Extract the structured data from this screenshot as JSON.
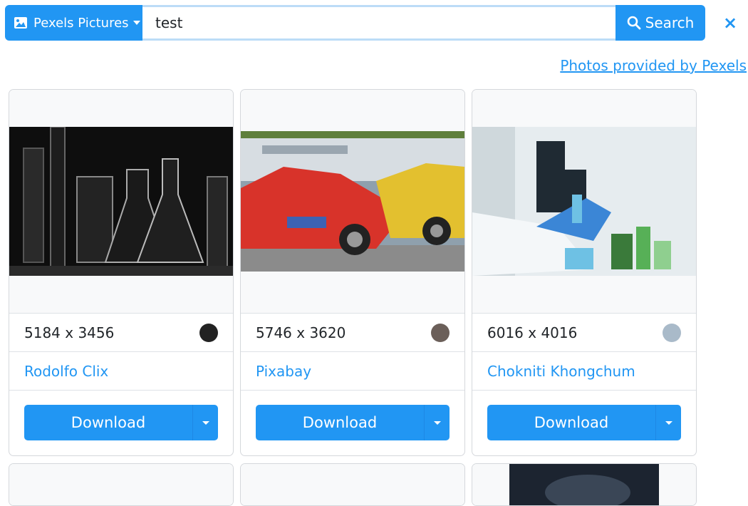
{
  "search": {
    "source_label": "Pexels Pictures",
    "query": "test",
    "button_label": "Search",
    "close_symbol": "×"
  },
  "credit": {
    "text": "Photos provided by Pexels"
  },
  "colors": {
    "accent": "#2196f3"
  },
  "photos": [
    {
      "dimensions": "5184 x 3456",
      "swatch": "#222222",
      "author": "Rodolfo Clix",
      "download_label": "Download",
      "image": "lab-glassware-dark"
    },
    {
      "dimensions": "5746 x 3620",
      "swatch": "#6b5f59",
      "author": "Pixabay",
      "download_label": "Download",
      "image": "car-crash-test"
    },
    {
      "dimensions": "6016 x 4016",
      "swatch": "#a9bac9",
      "author": "Chokniti Khongchum",
      "download_label": "Download",
      "image": "scientist-lab"
    }
  ],
  "next_row_images": [
    "placeholder",
    "placeholder",
    "dark-photo"
  ]
}
